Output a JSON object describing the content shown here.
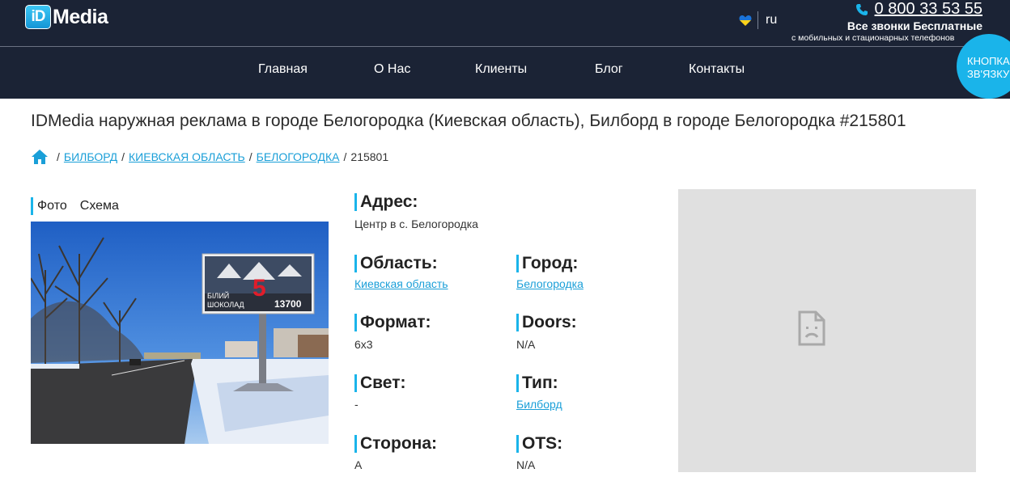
{
  "header": {
    "logo_mark": "iD",
    "logo_word": "Media",
    "lang": "ru",
    "phone": "0 800 33 53 55",
    "free_calls": "Все звонки Бесплатные",
    "free_calls_sub": "с мобильных и стационарных телефонов"
  },
  "nav": {
    "items": [
      {
        "label": "Главная"
      },
      {
        "label": "О Нас"
      },
      {
        "label": "Клиенты"
      },
      {
        "label": "Блог"
      },
      {
        "label": "Контакты"
      }
    ],
    "callback_button": "КНОПКА ЗВ'ЯЗКУ"
  },
  "page": {
    "title": "IDMedia наружная реклама в городе Белогородка (Киевская область), Билборд в городе Белогородка #215801",
    "breadcrumb": {
      "items": [
        "БИЛБОРД",
        "КИЕВСКАЯ ОБЛАСТЬ",
        "БЕЛОГОРОДКА"
      ],
      "current": "215801",
      "separator": "/"
    },
    "tabs": [
      "Фото",
      "Схема"
    ],
    "billboard_ad": {
      "line1": "БІЛИЙ",
      "line2": "ШОКОЛАД",
      "number": "5",
      "price": "13700"
    }
  },
  "details": {
    "address": {
      "label": "Адрес:",
      "value": "Центр в с. Белогородка"
    },
    "region": {
      "label": "Область:",
      "value": "Киевская область"
    },
    "city": {
      "label": "Город:",
      "value": "Белогородка"
    },
    "format": {
      "label": "Формат:",
      "value": "6x3"
    },
    "doors": {
      "label": "Doors:",
      "value": "N/A"
    },
    "light": {
      "label": "Свет:",
      "value": "-"
    },
    "type": {
      "label": "Тип:",
      "value": "Билборд"
    },
    "side": {
      "label": "Сторона:",
      "value": "A"
    },
    "ots": {
      "label": "OTS:",
      "value": "N/A"
    }
  },
  "colors": {
    "header_bg": "#1b2335",
    "accent": "#1ab4ea",
    "link": "#1a9fd8",
    "map_placeholder": "#e0e0e0"
  },
  "icons": [
    "ukraine-heart-icon",
    "phone-icon",
    "home-icon",
    "broken-image-icon"
  ]
}
